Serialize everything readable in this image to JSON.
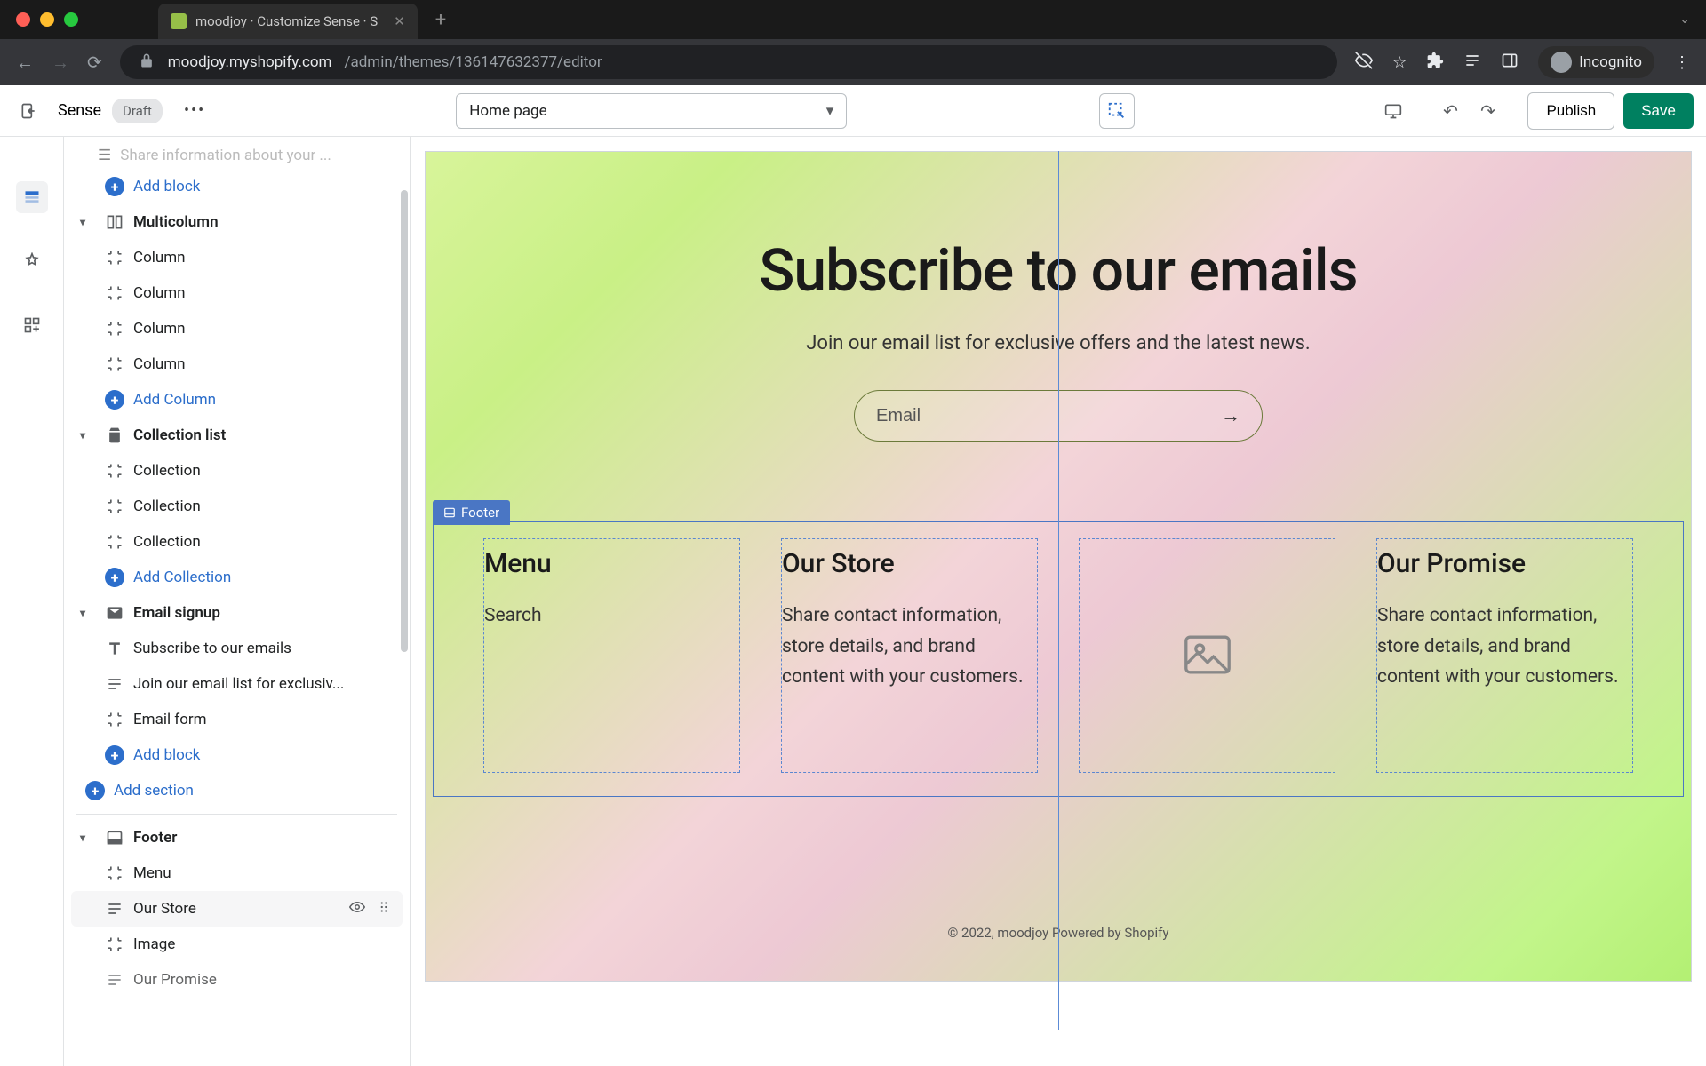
{
  "browser": {
    "tab_title": "moodjoy · Customize Sense · S",
    "url_host": "moodjoy.myshopify.com",
    "url_path": "/admin/themes/136147632377/editor",
    "incognito_label": "Incognito"
  },
  "topbar": {
    "theme_name": "Sense",
    "status_badge": "Draft",
    "page_selector": "Home page",
    "publish_label": "Publish",
    "save_label": "Save"
  },
  "tree": {
    "truncated_top": "Share information about your ...",
    "add_block": "Add block",
    "sections": {
      "multicolumn": {
        "label": "Multicolumn",
        "children": [
          "Column",
          "Column",
          "Column",
          "Column"
        ],
        "add": "Add Column"
      },
      "collection_list": {
        "label": "Collection list",
        "children": [
          "Collection",
          "Collection",
          "Collection"
        ],
        "add": "Add Collection"
      },
      "email_signup": {
        "label": "Email signup",
        "children": [
          "Subscribe to our emails",
          "Join our email list for exclusiv...",
          "Email form"
        ],
        "add": "Add block"
      },
      "add_section": "Add section",
      "footer": {
        "label": "Footer",
        "children": [
          "Menu",
          "Our Store",
          "Image",
          "Our Promise"
        ]
      }
    }
  },
  "preview": {
    "email": {
      "heading": "Subscribe to our emails",
      "subheading": "Join our email list for exclusive offers and the latest news.",
      "placeholder": "Email"
    },
    "footer_label": "Footer",
    "footer_cols": {
      "menu": {
        "title": "Menu",
        "link": "Search"
      },
      "our_store": {
        "title": "Our Store",
        "body": "Share contact information, store details, and brand content with your customers."
      },
      "our_promise": {
        "title": "Our Promise",
        "body": "Share contact information, store details, and brand content with your customers."
      }
    },
    "copyright": "© 2022, moodjoy Powered by Shopify"
  }
}
